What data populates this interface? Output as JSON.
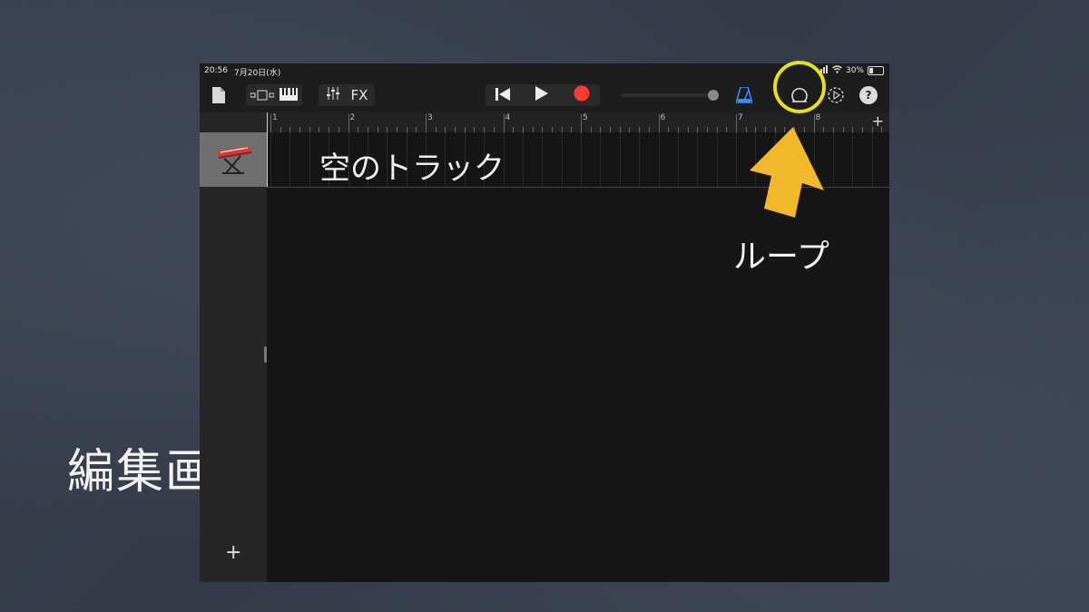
{
  "slide": {
    "title": "編集画面",
    "callout_label": "ループ",
    "highlight_color": "#e7e01a",
    "arrow_color": "#f0b82a"
  },
  "status": {
    "time": "20:56",
    "date": "7月20日(水)",
    "battery": "30%",
    "battery_level": 0.3
  },
  "toolbar": {
    "fx_label": "FX",
    "icons": [
      "document-icon",
      "view-toggle-icon",
      "keyboard-icon",
      "mixer-icon",
      "rewind-icon",
      "play-icon",
      "record-icon",
      "volume-slider",
      "metronome-icon",
      "loop-icon",
      "settings-icon",
      "help-icon"
    ],
    "record_color": "#ff3b30",
    "metronome_color": "#3a8cff",
    "help_label": "?"
  },
  "ruler": {
    "bars": [
      "1",
      "2",
      "3",
      "4",
      "5",
      "6",
      "7",
      "8"
    ],
    "add_label": "+"
  },
  "track": {
    "name": "空のトラック",
    "instrument_icon": "keyboard-instrument-icon"
  },
  "sidebar": {
    "add_label": "+"
  }
}
